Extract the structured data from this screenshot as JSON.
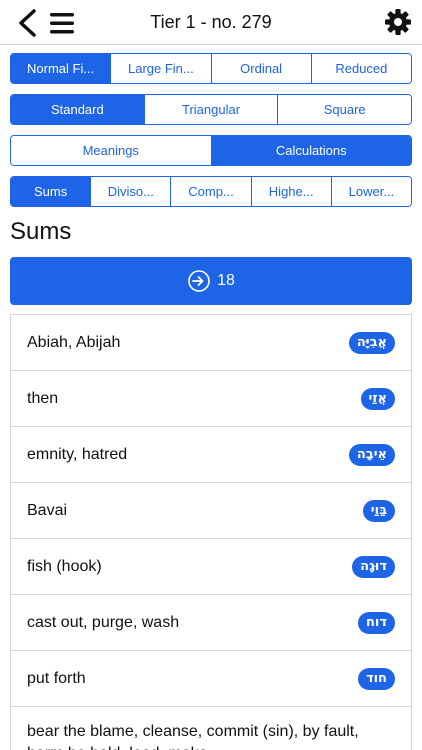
{
  "nav": {
    "title": "Tier 1 - no. 279",
    "back_icon": "chevron-left-icon",
    "menu_icon": "hamburger-menu-icon",
    "settings_icon": "gear-icon"
  },
  "segments": {
    "font": {
      "items": [
        "Normal Fi...",
        "Large Fin...",
        "Ordinal",
        "Reduced"
      ],
      "selected": "Normal Fi..."
    },
    "style": {
      "items": [
        "Standard",
        "Triangular",
        "Square"
      ],
      "selected": "Standard"
    },
    "view": {
      "items": [
        "Meanings",
        "Calculations"
      ],
      "selected": "Calculations"
    },
    "calc": {
      "items": [
        "Sums",
        "Diviso...",
        "Comp...",
        "Highe...",
        "Lower..."
      ],
      "selected": "Sums"
    }
  },
  "section_title": "Sums",
  "sum_button": {
    "icon": "enter-arrow-icon",
    "value": "18"
  },
  "rows": [
    {
      "meaning": "Abiah, Abijah",
      "hebrew": "אֲבִיָּה"
    },
    {
      "meaning": "then",
      "hebrew": "אֲזַי"
    },
    {
      "meaning": "emnity, hatred",
      "hebrew": "אֵיבָה"
    },
    {
      "meaning": "Bavai",
      "hebrew": "בַּוַי"
    },
    {
      "meaning": "fish (hook)",
      "hebrew": "דוּגָה"
    },
    {
      "meaning": "cast out, purge, wash",
      "hebrew": "דוח"
    },
    {
      "meaning": "put forth",
      "hebrew": "חוד"
    },
    {
      "meaning": "bear the blame, cleanse, commit (sin), by fault, harm be bold, lead, make, ...",
      "hebrew": ""
    }
  ],
  "colors": {
    "accent": "#1e64e6",
    "divider": "#d6d6d6"
  }
}
